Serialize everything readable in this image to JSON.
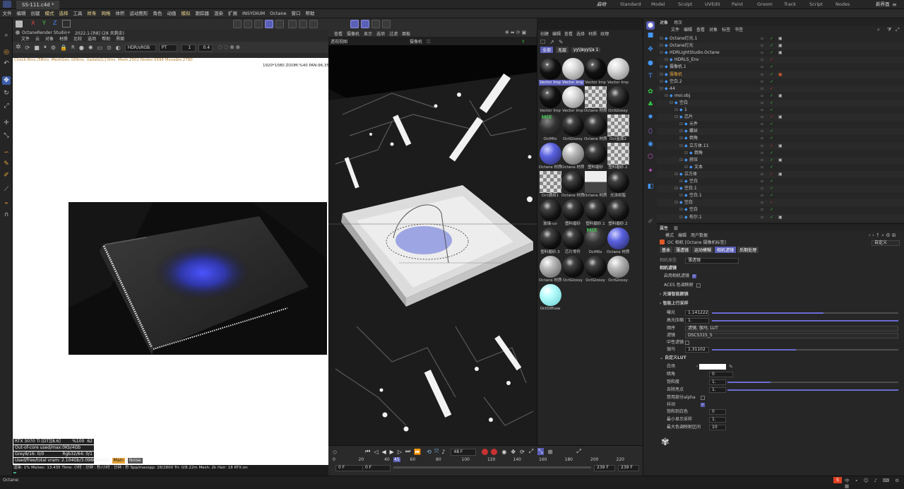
{
  "window": {
    "doc_tab": "SS-111.c4d *",
    "layouts": [
      "启动",
      "Standard",
      "Model",
      "Sculpt",
      "UVEdit",
      "Paint",
      "Groom",
      "Track",
      "Script",
      "Nodes"
    ],
    "new_layout": "新界面"
  },
  "menu": [
    "文件",
    "编辑",
    "创建",
    "模式",
    "选择",
    "工具",
    "样条",
    "网格",
    "体积",
    "运动图形",
    "角色",
    "动画",
    "模拟",
    "跟踪器",
    "渲染",
    "扩展",
    "INSYDIUM",
    "Octane",
    "窗口",
    "帮助"
  ],
  "toolbar": {
    "axes": [
      "X",
      "Y",
      "Z"
    ]
  },
  "octane_window": {
    "title": "OctaneRender Studio+",
    "version": "2022.1-[R8] (28 天剩余)",
    "menus": [
      "文件",
      "云",
      "对象",
      "材质",
      "比较",
      "选项",
      "帮助",
      "界面"
    ],
    "colorspace": "HDR/sRGB",
    "tonemap": "PT",
    "value1": "1",
    "value2": "0.4",
    "info_line": "Check:8ms./58ms. MeshGen:169ms. Update[L]:0ms. Mesh:2502 Nodes:5698 Movable:2780",
    "resolution_line": "1920*1080 ZOOM:%40  PAN:96,35",
    "stats": [
      {
        "label": "RTX 3070 Ti [DT][8.6]",
        "val1": "%100",
        "val2": "62"
      },
      {
        "label": "Out-of-core used/max:0Kb/4Gb",
        "val1": "",
        "val2": ""
      },
      {
        "label": "Grey8/16: 0/0",
        "val1": "Rgb32/64: 0/1",
        "val2": ""
      },
      {
        "label": "Used/free/total vram: 2.104Gb/3.098Gb/8Gb",
        "val1": "Main",
        "val2": "Noise"
      }
    ],
    "bottom_status": "渲染: 1%   Ms/sec: 13.435   Time: 小时 : 分钟 : 秒/小时 : 分钟 : 秒   Spp/maxspp: 28/2800   Tri: 0/8.22m   Mesh: 2k   Hair: 18   RTX:on"
  },
  "viewport": {
    "menus": [
      "查看",
      "摄像机",
      "显示",
      "选项",
      "过滤",
      "面板"
    ],
    "label": "透视视图",
    "camera": "摄像机"
  },
  "materials": {
    "menus": [
      "创建",
      "编辑",
      "查看",
      "选择",
      "材质",
      "纹理"
    ],
    "filters": [
      "全部",
      "无层",
      "уу\\|вуу\\|а 1"
    ],
    "items": [
      {
        "name": "Vector Imp",
        "style": "black"
      },
      {
        "name": "Vector Imp",
        "style": "white"
      },
      {
        "name": "Vector Imp",
        "style": "black"
      },
      {
        "name": "Vector Imp",
        "style": "white"
      },
      {
        "name": "Vector Imp",
        "style": "black"
      },
      {
        "name": "Vector Imp",
        "style": "white"
      },
      {
        "name": "Octane 材质",
        "style": "check"
      },
      {
        "name": "OctGlossy",
        "style": "dark"
      },
      {
        "name": "OctMix",
        "style": "mix"
      },
      {
        "name": "OctGlossy",
        "style": "dark"
      },
      {
        "name": "Octane 材质",
        "style": "dark"
      },
      {
        "name": "Oct金属2",
        "style": "check"
      },
      {
        "name": "Octane 材质",
        "style": "blue"
      },
      {
        "name": "Octane 材质",
        "style": "grey"
      },
      {
        "name": "塑料磨砂",
        "style": "dark"
      },
      {
        "name": "塑料磨砂.1",
        "style": "check"
      },
      {
        "name": "Oct通用1",
        "style": "check"
      },
      {
        "name": "Octane 材质",
        "style": "dark"
      },
      {
        "name": "Octane 材质",
        "style": "half"
      },
      {
        "name": "光泽树脂",
        "style": "dark"
      },
      {
        "name": "玻璃-uv",
        "style": "dark"
      },
      {
        "name": "塑料磨砂",
        "style": "dark"
      },
      {
        "name": "塑料磨砂.1",
        "style": "dark"
      },
      {
        "name": "塑料磨砂.2",
        "style": "dark"
      },
      {
        "name": "塑料磨砂.3",
        "style": "dark"
      },
      {
        "name": "芯片零件",
        "style": "dark"
      },
      {
        "name": "OctMix",
        "style": "mix"
      },
      {
        "name": "Octane 材质",
        "style": "blue"
      },
      {
        "name": "Octane 材质",
        "style": "grey"
      },
      {
        "name": "OctGlossy",
        "style": "dark"
      },
      {
        "name": "OctGlossy",
        "style": "dark"
      },
      {
        "name": "OctGlossy",
        "style": "grey"
      },
      {
        "name": "OctDiffuse",
        "style": "cyan"
      }
    ]
  },
  "objects": {
    "tabs": [
      "对象",
      "场次"
    ],
    "menus": [
      "文件",
      "编辑",
      "查看",
      "对象",
      "标签",
      "书签"
    ],
    "rows": [
      {
        "name": "Octane灯光.1",
        "indent": 0,
        "color": "#cfcfcf"
      },
      {
        "name": "Octane灯光",
        "indent": 0,
        "color": "#cfcfcf"
      },
      {
        "name": "HDRLightStudio.Octane",
        "indent": 0,
        "color": "#cfcfcf"
      },
      {
        "name": "HDRLS_Env",
        "indent": 1,
        "color": "#cfcfcf"
      },
      {
        "name": "摄像机.1",
        "indent": 0,
        "color": "#cfcfcf"
      },
      {
        "name": "摄像机",
        "indent": 0,
        "color": "#e3a33a"
      },
      {
        "name": "空白.2",
        "indent": 0,
        "color": "#cfcfcf"
      },
      {
        "name": "44",
        "indent": 0,
        "color": "#cfcfcf"
      },
      {
        "name": "moi.obj",
        "indent": 1,
        "color": "#cfcfcf"
      },
      {
        "name": "空白",
        "indent": 2,
        "color": "#cfcfcf"
      },
      {
        "name": "1",
        "indent": 3,
        "color": "#cfcfcf"
      },
      {
        "name": "芯片",
        "indent": 3,
        "color": "#cfcfcf"
      },
      {
        "name": "元件",
        "indent": 4,
        "color": "#cfcfcf"
      },
      {
        "name": "螺丝",
        "indent": 4,
        "color": "#cfcfcf"
      },
      {
        "name": "倒角",
        "indent": 4,
        "color": "#cfcfcf"
      },
      {
        "name": "立方体.11",
        "indent": 4,
        "color": "#cfcfcf"
      },
      {
        "name": "倒角",
        "indent": 5,
        "color": "#cfcfcf"
      },
      {
        "name": "挤压",
        "indent": 4,
        "color": "#cfcfcf"
      },
      {
        "name": "文本",
        "indent": 5,
        "color": "#cfcfcf"
      },
      {
        "name": "立方体",
        "indent": 3,
        "color": "#cfcfcf"
      },
      {
        "name": "空白",
        "indent": 4,
        "color": "#cfcfcf"
      },
      {
        "name": "空白.1",
        "indent": 3,
        "color": "#cfcfcf"
      },
      {
        "name": "空白.1",
        "indent": 4,
        "color": "#cfcfcf"
      },
      {
        "name": "空白",
        "indent": 3,
        "color": "#cfcfcf"
      },
      {
        "name": "空白",
        "indent": 4,
        "color": "#cfcfcf"
      },
      {
        "name": "布尔.1",
        "indent": 4,
        "color": "#cfcfcf"
      }
    ]
  },
  "attributes": {
    "tabs": [
      "属性",
      "层"
    ],
    "menus": [
      "模式",
      "编辑",
      "用户数据"
    ],
    "title": "OC 相机 [Octane 摄像机标签]",
    "preset": "自定义",
    "subtabs": [
      "基本",
      "薄透镜",
      "运动模糊",
      "相机滤镜",
      "后期处理"
    ],
    "active_subtab": "相机滤镜",
    "camera_type_label": "相机类型",
    "camera_type_value": "薄透镜",
    "section_title": "相机滤镜",
    "enable_label": "启用相机滤镜",
    "aces_label": "ACES 色调映射",
    "groups": [
      "光谱智能颜镜",
      "智能上行采样"
    ],
    "exposure": {
      "label": "曝光",
      "value": "1.141222",
      "fill": 0.6
    },
    "highlight": {
      "label": "高光压缩",
      "value": "1.",
      "fill": 1.0
    },
    "order": {
      "label": "顺序",
      "value": "滤镜, 伽马, LUT"
    },
    "filter": {
      "label": "滤镜",
      "value": "DSCS315_5"
    },
    "neutral": {
      "label": "中性滤镜"
    },
    "gamma": {
      "label": "伽马",
      "value": "1.31102",
      "fill": 0.45
    },
    "lut_section": "自定义LUT",
    "white_point_label": "白场",
    "vignette": {
      "label": "暗角",
      "value": "0"
    },
    "saturation": {
      "label": "饱和度",
      "value": "1.",
      "fill": 0.25
    },
    "remove_hotpixel": {
      "label": "去除亮点",
      "value": "1.",
      "fill": 1.0
    },
    "alpha_label": "禁用部分alpha",
    "dither_label": "抖动",
    "sat_white": {
      "label": "饱和到白色",
      "value": "0"
    },
    "min_spp": {
      "label": "最小显示采样",
      "value": "1."
    },
    "max_tonemap": {
      "label": "最大色调映射区间",
      "value": "10"
    }
  },
  "timeline": {
    "ticks": [
      "0",
      "20",
      "40",
      "60",
      "80",
      "100",
      "120",
      "140",
      "160",
      "180",
      "200",
      "220"
    ],
    "current_frame": "48 F",
    "start": "0 F",
    "start2": "0 F",
    "end": "239 F",
    "end2": "239 F",
    "frame_marker": "45"
  },
  "status": {
    "text": "Octane:"
  },
  "colors": {
    "accent": "#5b5fb8",
    "fill": "#6b6bd1",
    "orange": "#e3a33a",
    "red": "#c83232",
    "green": "#3fbf4f"
  }
}
